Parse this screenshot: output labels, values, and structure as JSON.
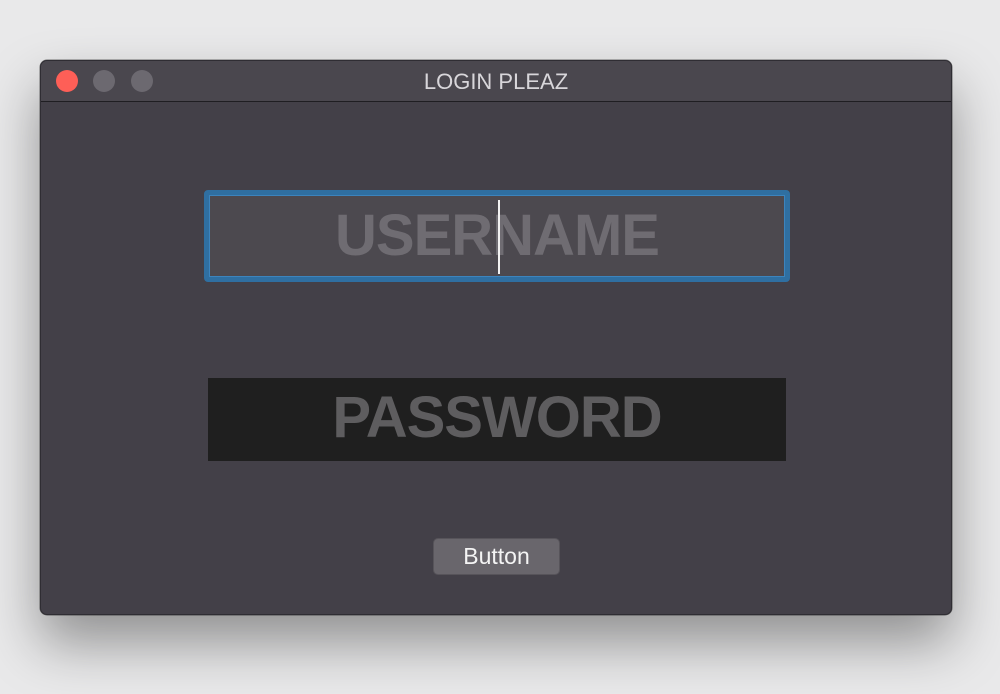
{
  "window": {
    "title": "LOGIN PLEAZ",
    "controls": {
      "close_color": "#fe5f57",
      "inactive_color": "#6c6970"
    }
  },
  "form": {
    "username": {
      "placeholder": "USERNAME",
      "value": "",
      "focused": true,
      "focus_ring_color": "#2f6fa1"
    },
    "password": {
      "placeholder": "PASSWORD",
      "value": ""
    },
    "submit": {
      "label": "Button"
    }
  }
}
